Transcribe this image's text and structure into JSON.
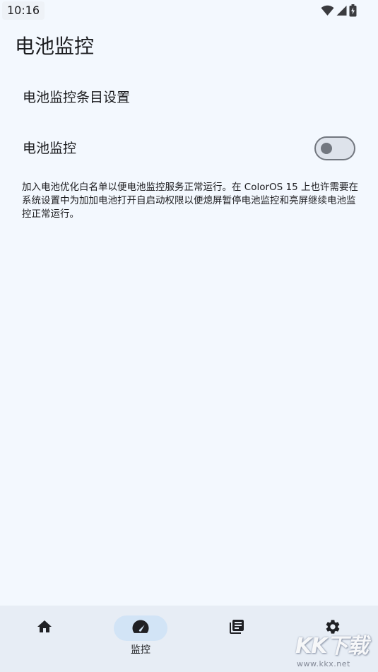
{
  "status_bar": {
    "time": "10:16",
    "icons": [
      "wifi-icon",
      "signal-icon",
      "battery-charging-icon"
    ]
  },
  "page": {
    "title": "电池监控"
  },
  "settings": {
    "items_setting_label": "电池监控条目设置",
    "monitor_label": "电池监控",
    "monitor_enabled": false,
    "description": "加入电池优化白名单以便电池监控服务正常运行。在 ColorOS 15 上也许需要在系统设置中为加加电池打开自启动权限以便熄屏暂停电池监控和亮屏继续电池监控正常运行。"
  },
  "bottom_nav": {
    "active": "monitor",
    "items": [
      {
        "id": "home",
        "icon": "home-icon",
        "label": ""
      },
      {
        "id": "monitor",
        "icon": "speedometer-icon",
        "label": "监控"
      },
      {
        "id": "logs",
        "icon": "library-books-icon",
        "label": ""
      },
      {
        "id": "settings",
        "icon": "gear-icon",
        "label": ""
      }
    ]
  },
  "watermark": {
    "logo_text": "KK下载",
    "url": "www.kkx.net"
  },
  "colors": {
    "background": "#f3f8fe",
    "nav_background": "#e7edf5",
    "nav_active_pill": "#d2e4f6",
    "toggle_track": "#dee3eb",
    "toggle_outline": "#72777f"
  }
}
